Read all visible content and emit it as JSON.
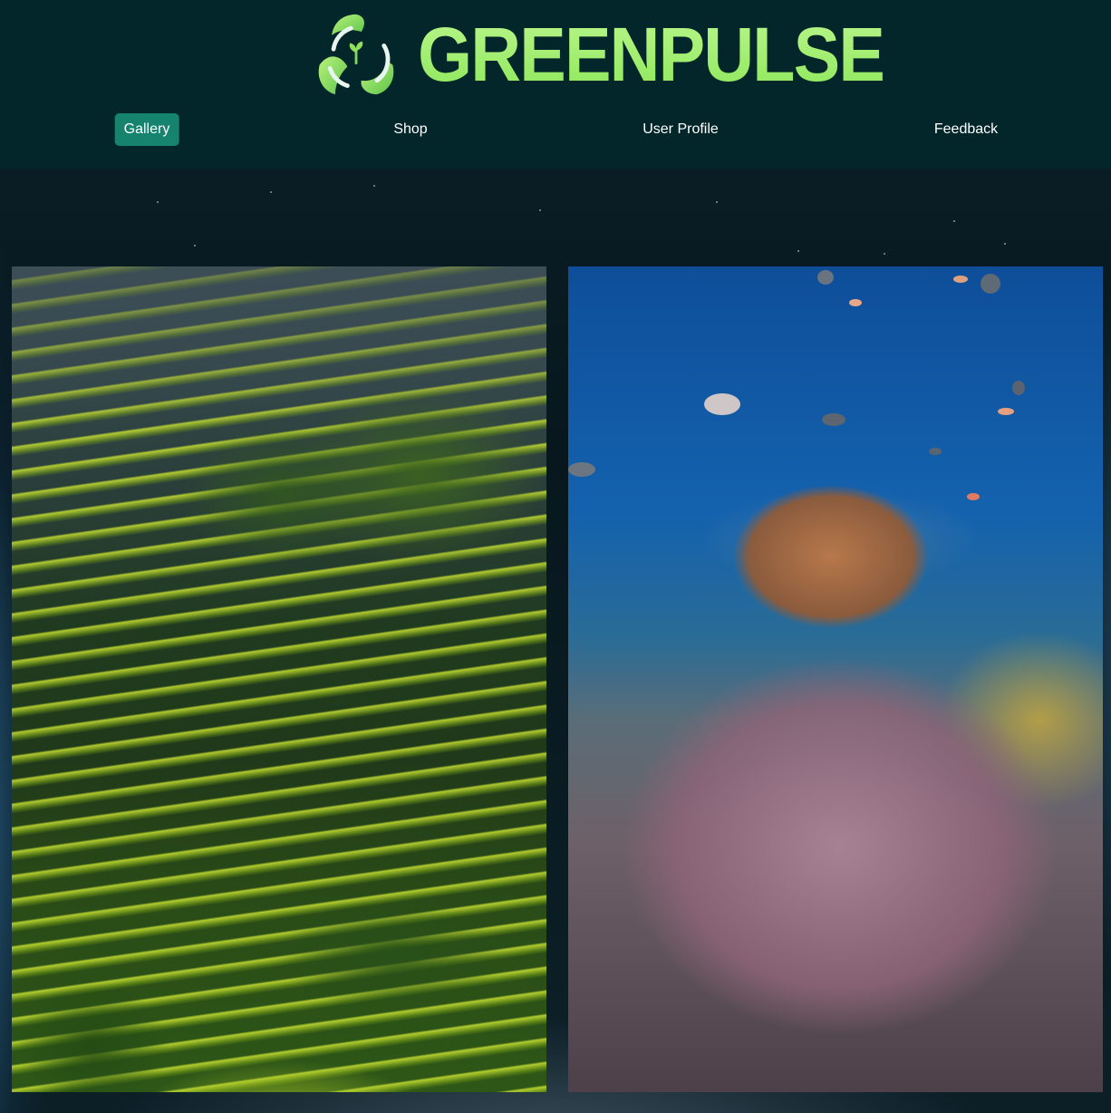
{
  "header": {
    "brand_name": "GREENPULSE",
    "logo_icon": "recycle-leaf-icon",
    "colors": {
      "background": "#03262a",
      "brand_text": "#a3f36c",
      "active_nav": "#16836f"
    }
  },
  "nav": {
    "items": [
      {
        "label": "Gallery",
        "active": true
      },
      {
        "label": "Shop",
        "active": false
      },
      {
        "label": "User Profile",
        "active": false
      },
      {
        "label": "Feedback",
        "active": false
      }
    ]
  },
  "gallery": {
    "images": [
      {
        "subject": "rice-terraces-photo"
      },
      {
        "subject": "coral-reef-photo"
      }
    ]
  }
}
